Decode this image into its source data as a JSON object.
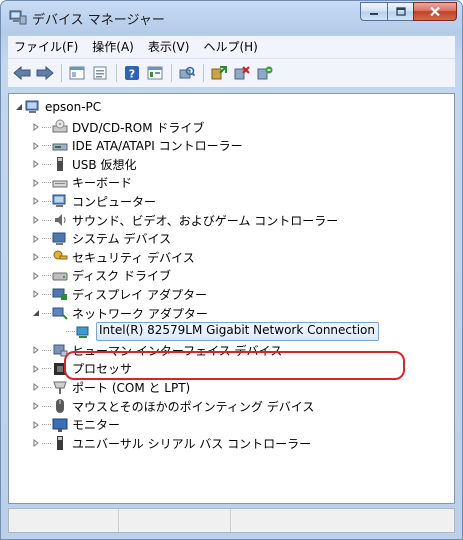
{
  "window": {
    "title": "デバイス マネージャー"
  },
  "menubar": {
    "items": [
      "ファイル(F)",
      "操作(A)",
      "表示(V)",
      "ヘルプ(H)"
    ]
  },
  "toolbar": {
    "buttons": [
      "back-icon",
      "forward-icon",
      "show-hide-tree-icon",
      "properties-icon",
      "help-icon",
      "view-icon",
      "scan-hardware-icon",
      "update-driver-icon",
      "disable-device-icon",
      "uninstall-device-icon"
    ]
  },
  "tree": {
    "root": "epson-PC",
    "items": [
      {
        "label": "DVD/CD-ROM ドライブ",
        "icon": "dvd-drive-icon",
        "expanded": false
      },
      {
        "label": "IDE ATA/ATAPI コントローラー",
        "icon": "ide-controller-icon",
        "expanded": false
      },
      {
        "label": "USB 仮想化",
        "icon": "usb-icon",
        "expanded": false
      },
      {
        "label": "キーボード",
        "icon": "keyboard-icon",
        "expanded": false
      },
      {
        "label": "コンピューター",
        "icon": "computer-icon",
        "expanded": false
      },
      {
        "label": "サウンド、ビデオ、およびゲーム コントローラー",
        "icon": "speaker-icon",
        "expanded": false
      },
      {
        "label": "システム デバイス",
        "icon": "system-device-icon",
        "expanded": false
      },
      {
        "label": "セキュリティ デバイス",
        "icon": "security-device-icon",
        "expanded": false
      },
      {
        "label": "ディスク ドライブ",
        "icon": "disk-drive-icon",
        "expanded": false
      },
      {
        "label": "ディスプレイ アダプター",
        "icon": "display-adapter-icon",
        "expanded": false
      },
      {
        "label": "ネットワーク アダプター",
        "icon": "network-adapter-icon",
        "expanded": true
      },
      {
        "label": "Intel(R) 82579LM Gigabit Network Connection",
        "icon": "network-card-icon",
        "child": true
      },
      {
        "label": "ヒューマン インターフェイス デバイス",
        "icon": "hid-icon",
        "expanded": false
      },
      {
        "label": "プロセッサ",
        "icon": "processor-icon",
        "expanded": false
      },
      {
        "label": "ポート (COM と LPT)",
        "icon": "port-icon",
        "expanded": false
      },
      {
        "label": "マウスとそのほかのポインティング デバイス",
        "icon": "mouse-icon",
        "expanded": false
      },
      {
        "label": "モニター",
        "icon": "monitor-icon",
        "expanded": false
      },
      {
        "label": "ユニバーサル シリアル バス コントローラー",
        "icon": "usb-controller-icon",
        "expanded": false
      }
    ]
  },
  "colors": {
    "highlight_ring": "#d4262f",
    "selection": "#dce9fb"
  }
}
